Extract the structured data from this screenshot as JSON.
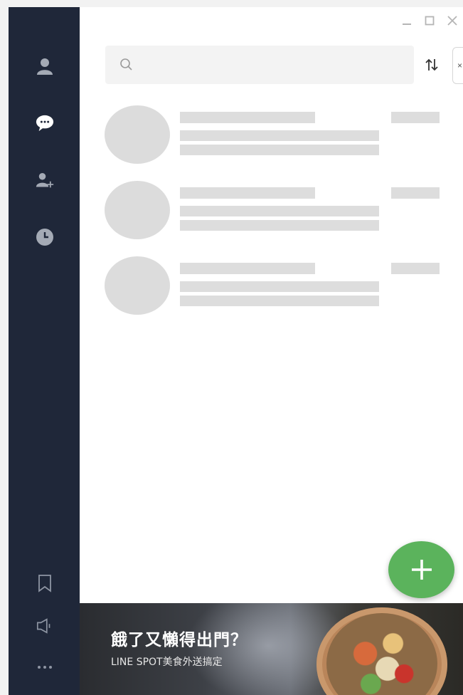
{
  "sidebar": {
    "nav": [
      {
        "icon": "person-icon"
      },
      {
        "icon": "chat-icon",
        "active": true
      },
      {
        "icon": "add-friend-icon"
      },
      {
        "icon": "clock-icon"
      }
    ],
    "bottom": [
      {
        "icon": "bookmark-icon"
      },
      {
        "icon": "megaphone-icon"
      },
      {
        "icon": "more-icon"
      }
    ]
  },
  "window_controls": [
    "minimize-icon",
    "maximize-icon",
    "close-icon"
  ],
  "search": {
    "value": "",
    "placeholder": ""
  },
  "colors": {
    "sidebar_bg": "#1f2739",
    "fab": "#5bb35c",
    "placeholder": "#dddddd",
    "search_bg": "#f3f3f3"
  },
  "chat_list": {
    "loading_rows": 3
  },
  "banner": {
    "title": "餓了又懶得出門？",
    "subtitle": "LINE SPOT美食外送搞定"
  }
}
